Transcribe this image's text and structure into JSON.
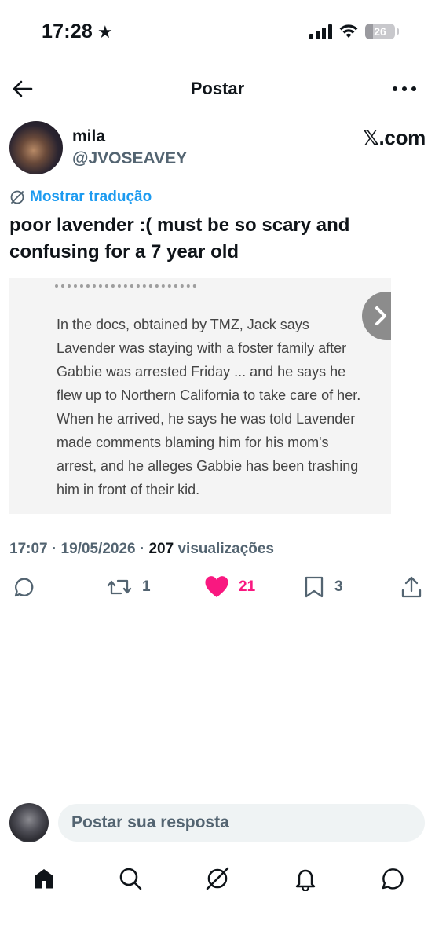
{
  "status_bar": {
    "time": "17:28",
    "star_icon": "star-icon",
    "battery": "26",
    "battery_level": 0.26
  },
  "header": {
    "title": "Postar"
  },
  "post": {
    "author_name": "mila",
    "author_handle": "@JVOSEAVEY",
    "source_label": "𝕏.com",
    "translate_label": "Mostrar tradução",
    "text": "poor lavender :( must be so scary and confusing for a 7 year old",
    "media_text": "In the docs, obtained by TMZ, Jack says Lavender was staying with a foster family after Gabbie was arrested Friday ... and he says he flew up to Northern California to take care of her. When he arrived, he says he was told Lavender made comments blaming him for his mom's arrest, and he alleges Gabbie has been trashing him in front of their kid.",
    "time": "17:07",
    "date": "19/05/2026",
    "views_count": "207",
    "views_label": "visualizações",
    "retweets": "1",
    "likes": "21",
    "bookmarks": "3"
  },
  "reply": {
    "placeholder": "Postar sua resposta"
  },
  "colors": {
    "accent": "#1d9bf0",
    "like": "#f91880",
    "secondary_text": "#536471",
    "primary_text": "#0f1419"
  }
}
